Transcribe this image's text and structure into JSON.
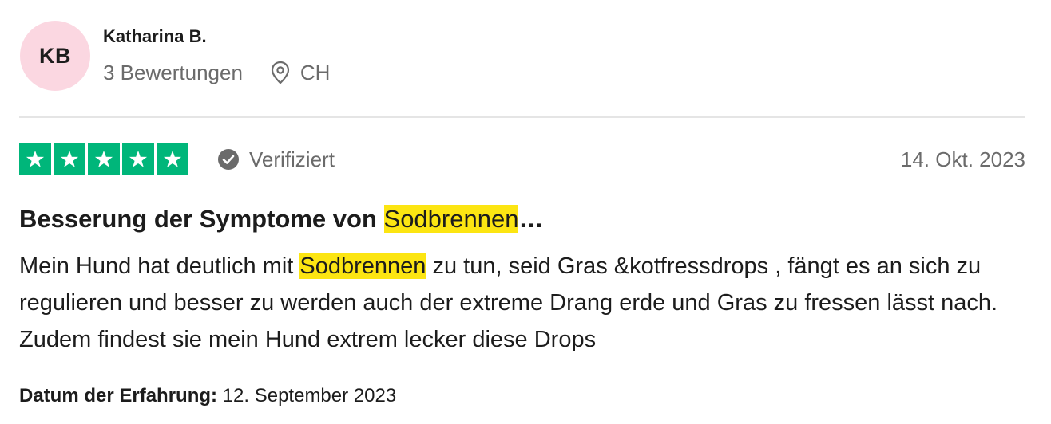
{
  "reviewer": {
    "initials": "KB",
    "name": "Katharina B.",
    "review_count": "3 Bewertungen",
    "country": "CH",
    "avatar_color": "#fbd7e1"
  },
  "rating": {
    "stars": 5,
    "max_stars": 5,
    "star_color": "#00b67a"
  },
  "verified_label": "Verifiziert",
  "review_date": "14. Okt. 2023",
  "review": {
    "title_before": "Besserung der Symptome von ",
    "title_highlight": "Sodbrennen",
    "title_after": "…",
    "body_before": "Mein Hund hat deutlich mit ",
    "body_highlight": "Sodbrennen",
    "body_after": " zu tun, seid Gras &kotfressdrops , fängt es an sich zu regulieren und besser zu werden auch der extreme Drang erde und Gras zu fressen lässt nach. Zudem findest sie mein Hund extrem lecker diese Drops",
    "highlight_color": "#fce512"
  },
  "experience": {
    "label": "Datum der Erfahrung:",
    "date": "12. September 2023"
  },
  "icons": {
    "location": "map-pin-icon",
    "verified": "check-circle-icon",
    "star": "star-icon"
  }
}
